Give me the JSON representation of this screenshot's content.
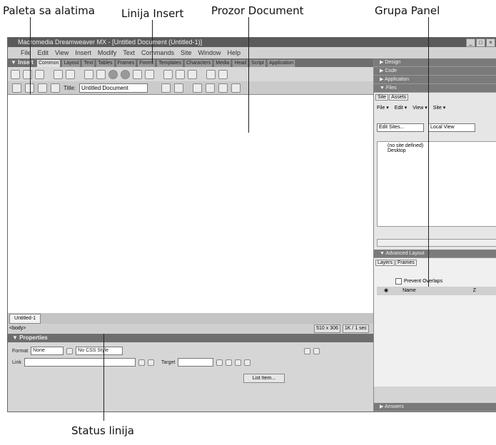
{
  "callouts": {
    "palette": "Paleta sa alatima",
    "insert_line": "Linija Insert",
    "document_window": "Prozor Document",
    "panel_group": "Grupa Panel",
    "status_line": "Status linija"
  },
  "window": {
    "title": "Macromedia Dreamweaver MX - [Untitled Document (Untitled-1)]",
    "min": "_",
    "max": "□",
    "close": "×"
  },
  "menubar": [
    "File",
    "Edit",
    "View",
    "Insert",
    "Modify",
    "Text",
    "Commands",
    "Site",
    "Window",
    "Help"
  ],
  "insert_bar": {
    "title": "▼ Insert",
    "tabs": [
      "Common",
      "Layout",
      "Text",
      "Tables",
      "Frames",
      "Forms",
      "Templates",
      "Characters",
      "Media",
      "Head",
      "Script",
      "Application"
    ]
  },
  "doc_toolbar": {
    "title_label": "Title:",
    "title_value": "Untitled Document"
  },
  "document": {
    "tab_label": "Untitled-1",
    "tag_selector": "<body>",
    "size": "510 x 306",
    "download": "1K / 1 sec"
  },
  "properties": {
    "title": "▼ Properties",
    "format_label": "Format",
    "format_value": "None",
    "style_value": "No CSS Style",
    "link_label": "Link",
    "target_label": "Target",
    "list_item_label": "List Item..."
  },
  "right_panels": {
    "design": "▶ Design",
    "code": "▶ Code",
    "application": "▶ Application",
    "files": "▼ Files",
    "files_tabs": [
      "Site",
      "Assets"
    ],
    "files_menu": [
      "File ▾",
      "Edit ▾",
      "View ▾",
      "Site ▾"
    ],
    "site_select": "Edit Sites...",
    "view_select": "Local View",
    "tree": [
      "(no site defined)",
      "Desktop"
    ],
    "advanced_layout": "▼ Advanced Layout",
    "adv_tabs": [
      "Layers",
      "Frames"
    ],
    "prevent_overlaps": "Prevent Overlaps",
    "grid_header": [
      "Name",
      "Z"
    ],
    "answers": "▶ Answers"
  }
}
